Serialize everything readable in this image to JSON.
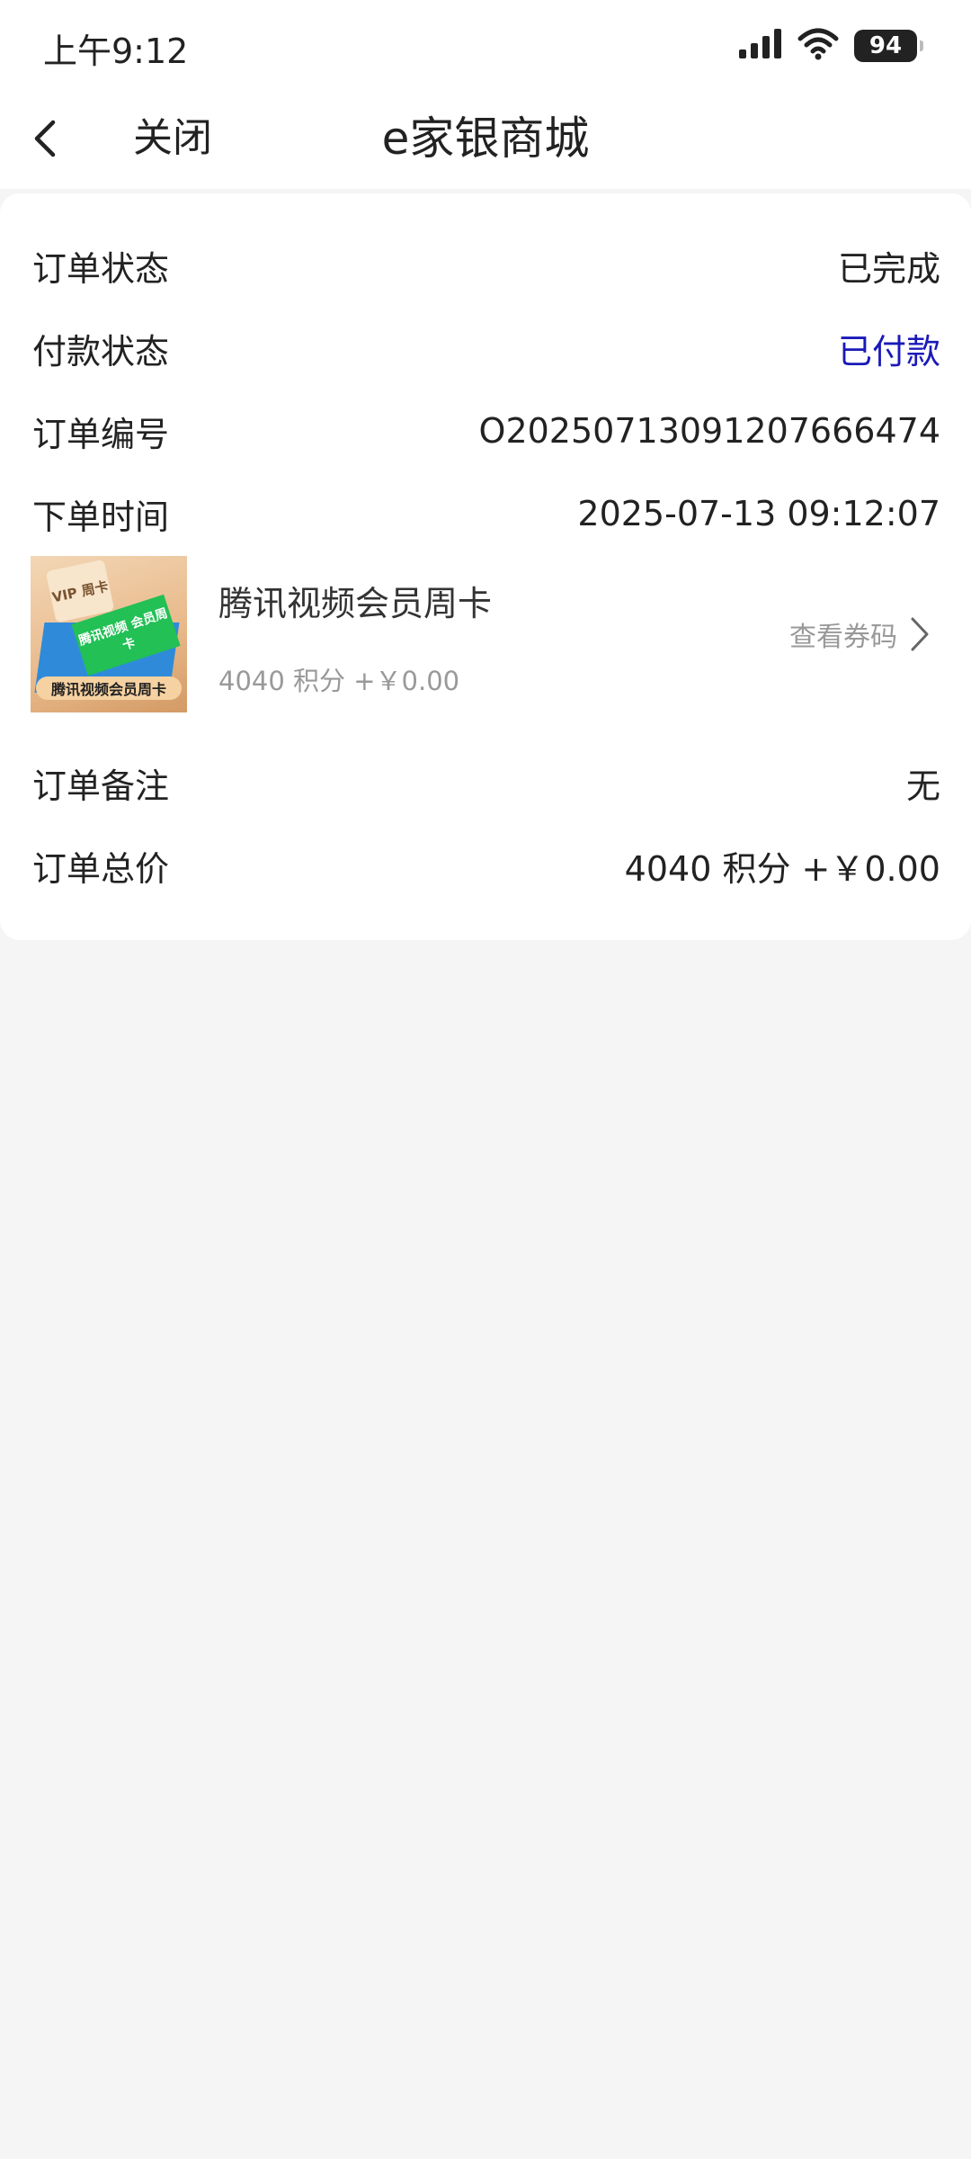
{
  "status_bar": {
    "time": "上午9:12",
    "battery": "94",
    "icons": [
      "signal-icon",
      "wifi-icon",
      "battery-icon"
    ]
  },
  "nav": {
    "close_label": "关闭",
    "title": "e家银商城"
  },
  "order": {
    "status_label": "订单状态",
    "status_value": "已完成",
    "payment_label": "付款状态",
    "payment_value": "已付款",
    "number_label": "订单编号",
    "number_value": "O20250713091207666474",
    "time_label": "下单时间",
    "time_value": "2025-07-13 09:12:07",
    "remark_label": "订单备注",
    "remark_value": "无",
    "total_label": "订单总价",
    "total_value": "4040 积分 +￥0.00"
  },
  "product": {
    "name": "腾讯视频会员周卡",
    "price": "4040 积分 +￥0.00",
    "view_code_label": "查看券码",
    "thumb_card_text": "VIP 周卡",
    "thumb_green_text": "腾讯视频 会员周卡",
    "thumb_banner_text": "腾讯视频会员周卡"
  },
  "colors": {
    "accent_blue": "#1a1ab8",
    "background": "#f5f5f5",
    "card": "#ffffff",
    "muted_text": "#999999"
  }
}
